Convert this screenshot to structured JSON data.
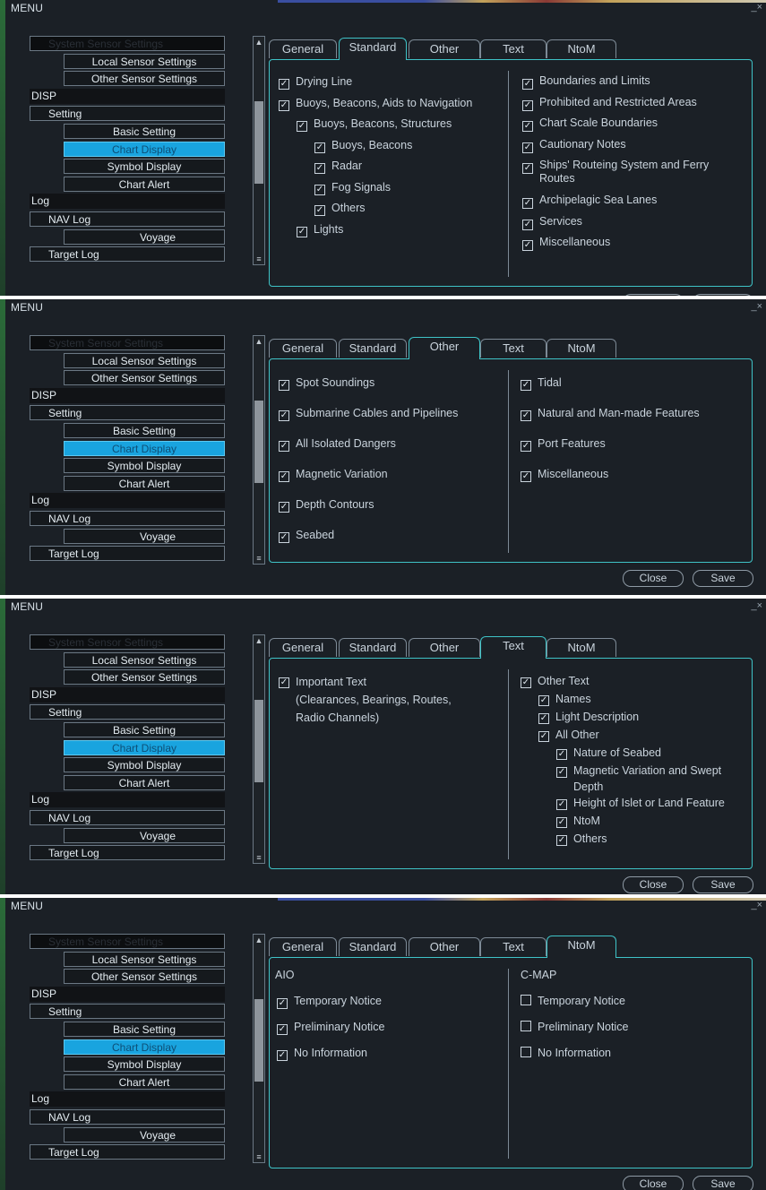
{
  "menu_title": "MENU",
  "close_glyph": "_×",
  "menu_items": [
    {
      "label": "System Sensor Settings",
      "level": "lvl1",
      "state": "dim"
    },
    {
      "label": "Local Sensor Settings",
      "level": "lvl2"
    },
    {
      "label": "Other Sensor Settings",
      "level": "lvl2"
    },
    {
      "label": "DISP",
      "level": "lvl0"
    },
    {
      "label": "Setting",
      "level": "lvl1"
    },
    {
      "label": "Basic Setting",
      "level": "lvl2"
    },
    {
      "label": "Chart Display",
      "level": "lvl2",
      "state": "sel"
    },
    {
      "label": "Symbol Display",
      "level": "lvl2"
    },
    {
      "label": "Chart Alert",
      "level": "lvl2"
    },
    {
      "label": "Log",
      "level": "lvl0"
    },
    {
      "label": "NAV Log",
      "level": "lvl1"
    },
    {
      "label": "Voyage",
      "level": "lvl2b"
    },
    {
      "label": "Target Log",
      "level": "lvl1"
    }
  ],
  "tabs": [
    "General",
    "Standard",
    "Other",
    "Text",
    "NtoM"
  ],
  "buttons": {
    "close": "Close",
    "save": "Save"
  },
  "panels": [
    {
      "active_tab": "Standard",
      "left": [
        {
          "label": "Drying Line",
          "checked": true,
          "indent": 0
        },
        {
          "label": "Buoys, Beacons, Aids to Navigation",
          "checked": true,
          "indent": 0
        },
        {
          "label": "Buoys, Beacons, Structures",
          "checked": true,
          "indent": 1
        },
        {
          "label": "Buoys, Beacons",
          "checked": true,
          "indent": 2
        },
        {
          "label": "Radar",
          "checked": true,
          "indent": 2
        },
        {
          "label": "Fog Signals",
          "checked": true,
          "indent": 2
        },
        {
          "label": "Others",
          "checked": true,
          "indent": 2
        },
        {
          "label": "Lights",
          "checked": true,
          "indent": 1
        }
      ],
      "right": [
        {
          "label": "Boundaries and Limits",
          "checked": true
        },
        {
          "label": "Prohibited and Restricted Areas",
          "checked": true
        },
        {
          "label": "Chart Scale Boundaries",
          "checked": true
        },
        {
          "label": "Cautionary Notes",
          "checked": true
        },
        {
          "label": "Ships' Routeing System and Ferry\nRoutes",
          "checked": true
        },
        {
          "label": "Archipelagic Sea Lanes",
          "checked": true
        },
        {
          "label": "Services",
          "checked": true
        },
        {
          "label": "Miscellaneous",
          "checked": true
        }
      ]
    },
    {
      "active_tab": "Other",
      "left": [
        {
          "label": "Spot Soundings",
          "checked": true
        },
        {
          "label": "Submarine Cables and Pipelines",
          "checked": true
        },
        {
          "label": "All Isolated Dangers",
          "checked": true
        },
        {
          "label": "Magnetic Variation",
          "checked": true
        },
        {
          "label": "Depth Contours",
          "checked": true
        },
        {
          "label": "Seabed",
          "checked": true
        }
      ],
      "right": [
        {
          "label": "Tidal",
          "checked": true
        },
        {
          "label": "Natural and Man-made Features",
          "checked": true
        },
        {
          "label": "Port Features",
          "checked": true
        },
        {
          "label": "Miscellaneous",
          "checked": true
        }
      ]
    },
    {
      "active_tab": "Text",
      "left": [
        {
          "label": "Important Text\n(Clearances, Bearings, Routes,\nRadio Channels)",
          "checked": true,
          "indent": 0
        }
      ],
      "right": [
        {
          "label": "Other Text",
          "checked": true,
          "indent": 0
        },
        {
          "label": "Names",
          "checked": true,
          "indent": 1
        },
        {
          "label": "Light Description",
          "checked": true,
          "indent": 1
        },
        {
          "label": "All Other",
          "checked": true,
          "indent": 1
        },
        {
          "label": "Nature of Seabed",
          "checked": true,
          "indent": 2
        },
        {
          "label": "Magnetic Variation and Swept\nDepth",
          "checked": true,
          "indent": 2
        },
        {
          "label": "Height of Islet or Land Feature",
          "checked": true,
          "indent": 2
        },
        {
          "label": "NtoM",
          "checked": true,
          "indent": 2
        },
        {
          "label": "Others",
          "checked": true,
          "indent": 2
        }
      ]
    },
    {
      "active_tab": "NtoM",
      "left_header": "AIO",
      "right_header": "C-MAP",
      "left": [
        {
          "label": "Temporary Notice",
          "checked": true
        },
        {
          "label": "Preliminary Notice",
          "checked": true
        },
        {
          "label": "No Information",
          "checked": true
        }
      ],
      "right": [
        {
          "label": "Temporary Notice",
          "checked": false
        },
        {
          "label": "Preliminary Notice",
          "checked": false
        },
        {
          "label": "No Information",
          "checked": false
        }
      ]
    }
  ]
}
